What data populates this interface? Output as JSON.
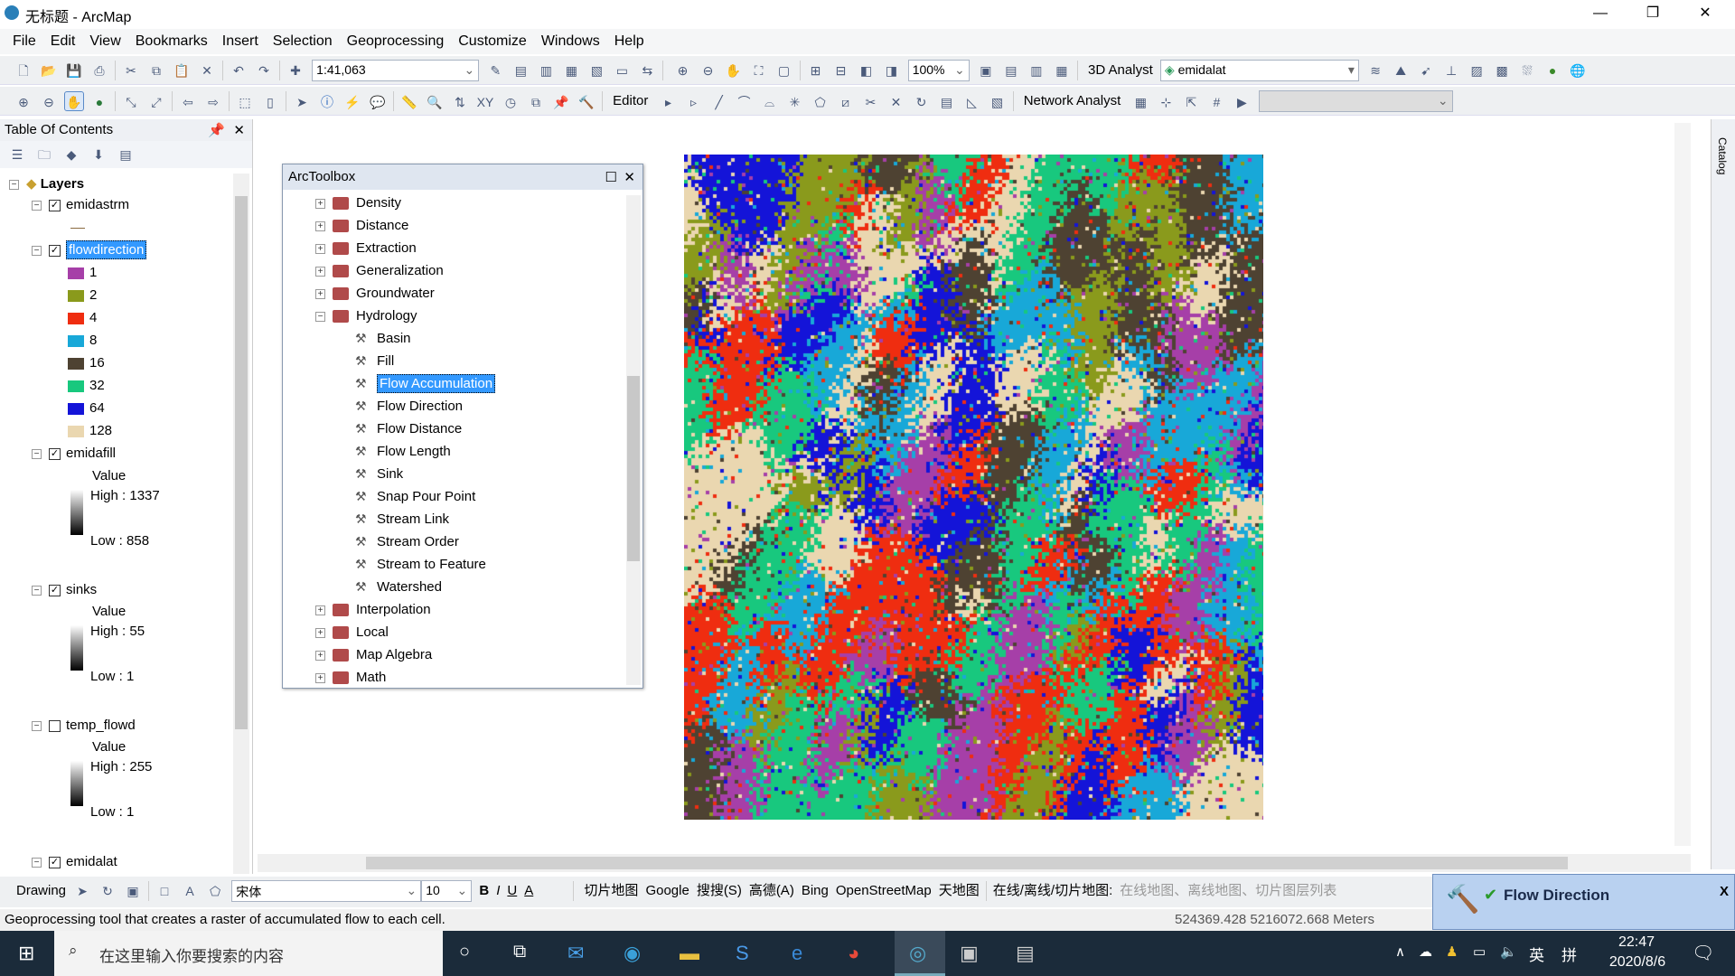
{
  "window": {
    "title": "无标题 - ArcMap",
    "min": "—",
    "max": "❐",
    "close": "✕"
  },
  "menu": [
    "File",
    "Edit",
    "View",
    "Bookmarks",
    "Insert",
    "Selection",
    "Geoprocessing",
    "Customize",
    "Windows",
    "Help"
  ],
  "toolbar": {
    "scale": "1:41,063",
    "zoom_pct": "100%",
    "analyst3d": "3D Analyst",
    "layer_select": "emidalat",
    "editor": "Editor",
    "network": "Network Analyst"
  },
  "toc": {
    "title": "Table Of Contents",
    "root": "Layers",
    "layers": [
      {
        "name": "emidastrm",
        "checked": true
      },
      {
        "name": "flowdirection",
        "checked": true,
        "classes": [
          {
            "label": "1",
            "color": "#a63fa8"
          },
          {
            "label": "2",
            "color": "#8a9a1c"
          },
          {
            "label": "4",
            "color": "#ef2d10"
          },
          {
            "label": "8",
            "color": "#18a8d8"
          },
          {
            "label": "16",
            "color": "#4e4232"
          },
          {
            "label": "32",
            "color": "#18c87e"
          },
          {
            "label": "64",
            "color": "#1414d8"
          },
          {
            "label": "128",
            "color": "#ead7b0"
          }
        ]
      },
      {
        "name": "emidafill",
        "checked": true,
        "value": "Value",
        "high": "High : 1337",
        "low": "Low : 858"
      },
      {
        "name": "sinks",
        "checked": true,
        "value": "Value",
        "high": "High : 55",
        "low": "Low : 1"
      },
      {
        "name": "temp_flowd",
        "checked": false,
        "value": "Value",
        "high": "High : 255",
        "low": "Low : 1"
      },
      {
        "name": "emidalat",
        "checked": true
      }
    ]
  },
  "toolbox": {
    "title": "ArcToolbox",
    "items": [
      {
        "label": "Density",
        "type": "toolset"
      },
      {
        "label": "Distance",
        "type": "toolset"
      },
      {
        "label": "Extraction",
        "type": "toolset"
      },
      {
        "label": "Generalization",
        "type": "toolset"
      },
      {
        "label": "Groundwater",
        "type": "toolset"
      },
      {
        "label": "Hydrology",
        "type": "toolset-open"
      },
      {
        "label": "Basin",
        "type": "tool"
      },
      {
        "label": "Fill",
        "type": "tool"
      },
      {
        "label": "Flow Accumulation",
        "type": "tool",
        "selected": true
      },
      {
        "label": "Flow Direction",
        "type": "tool"
      },
      {
        "label": "Flow Distance",
        "type": "tool"
      },
      {
        "label": "Flow Length",
        "type": "tool"
      },
      {
        "label": "Sink",
        "type": "tool"
      },
      {
        "label": "Snap Pour Point",
        "type": "tool"
      },
      {
        "label": "Stream Link",
        "type": "tool"
      },
      {
        "label": "Stream Order",
        "type": "tool"
      },
      {
        "label": "Stream to Feature",
        "type": "tool"
      },
      {
        "label": "Watershed",
        "type": "tool"
      },
      {
        "label": "Interpolation",
        "type": "toolset"
      },
      {
        "label": "Local",
        "type": "toolset"
      },
      {
        "label": "Map Algebra",
        "type": "toolset"
      },
      {
        "label": "Math",
        "type": "toolset"
      }
    ]
  },
  "drawing": {
    "label": "Drawing",
    "font": "宋体",
    "size": "10",
    "bold": "B",
    "italic": "I",
    "underline": "U",
    "fontcolor": "A",
    "menus": [
      "切片地图",
      "Google",
      "搜搜(S)",
      "高德(A)",
      "Bing",
      "OpenStreetMap",
      "天地图"
    ],
    "online_label": "在线/离线/切片地图:",
    "online_value": "在线地图、离线地图、切片图层列表"
  },
  "status": {
    "text": "Geoprocessing tool that creates a raster of accumulated flow to each cell.",
    "coords": "524369.428  5216072.668 Meters"
  },
  "popup": {
    "title": "Flow Direction",
    "close": "X"
  },
  "taskbar": {
    "search": "在这里输入你要搜索的内容",
    "time": "22:47",
    "date": "2020/8/6",
    "ime1": "英",
    "ime2": "拼"
  },
  "catalog_tab": "Catalog"
}
